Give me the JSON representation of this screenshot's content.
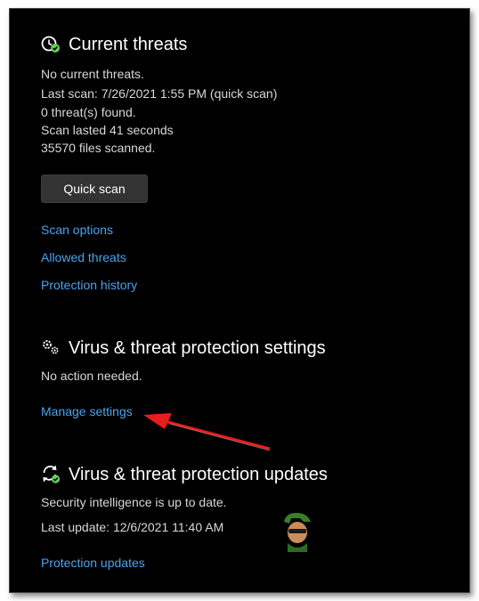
{
  "current_threats": {
    "title": "Current threats",
    "icon": "shield-clock-icon",
    "lines": [
      "No current threats.",
      "Last scan: 7/26/2021 1:55 PM (quick scan)",
      "0 threat(s) found.",
      "Scan lasted 41 seconds",
      "35570 files scanned."
    ],
    "quick_scan_label": "Quick scan",
    "links": [
      "Scan options",
      "Allowed threats",
      "Protection history"
    ]
  },
  "settings": {
    "title": "Virus & threat protection settings",
    "icon": "gears-icon",
    "status": "No action needed.",
    "link": "Manage settings"
  },
  "updates": {
    "title": "Virus & threat protection updates",
    "icon": "refresh-check-icon",
    "status": "Security intelligence is up to date.",
    "last_update": "Last update: 12/6/2021 11:40 AM",
    "link": "Protection updates"
  },
  "colors": {
    "background": "#000000",
    "link": "#4aa3ef",
    "check_green": "#6ccb5f",
    "arrow_red": "#e81c1c"
  }
}
